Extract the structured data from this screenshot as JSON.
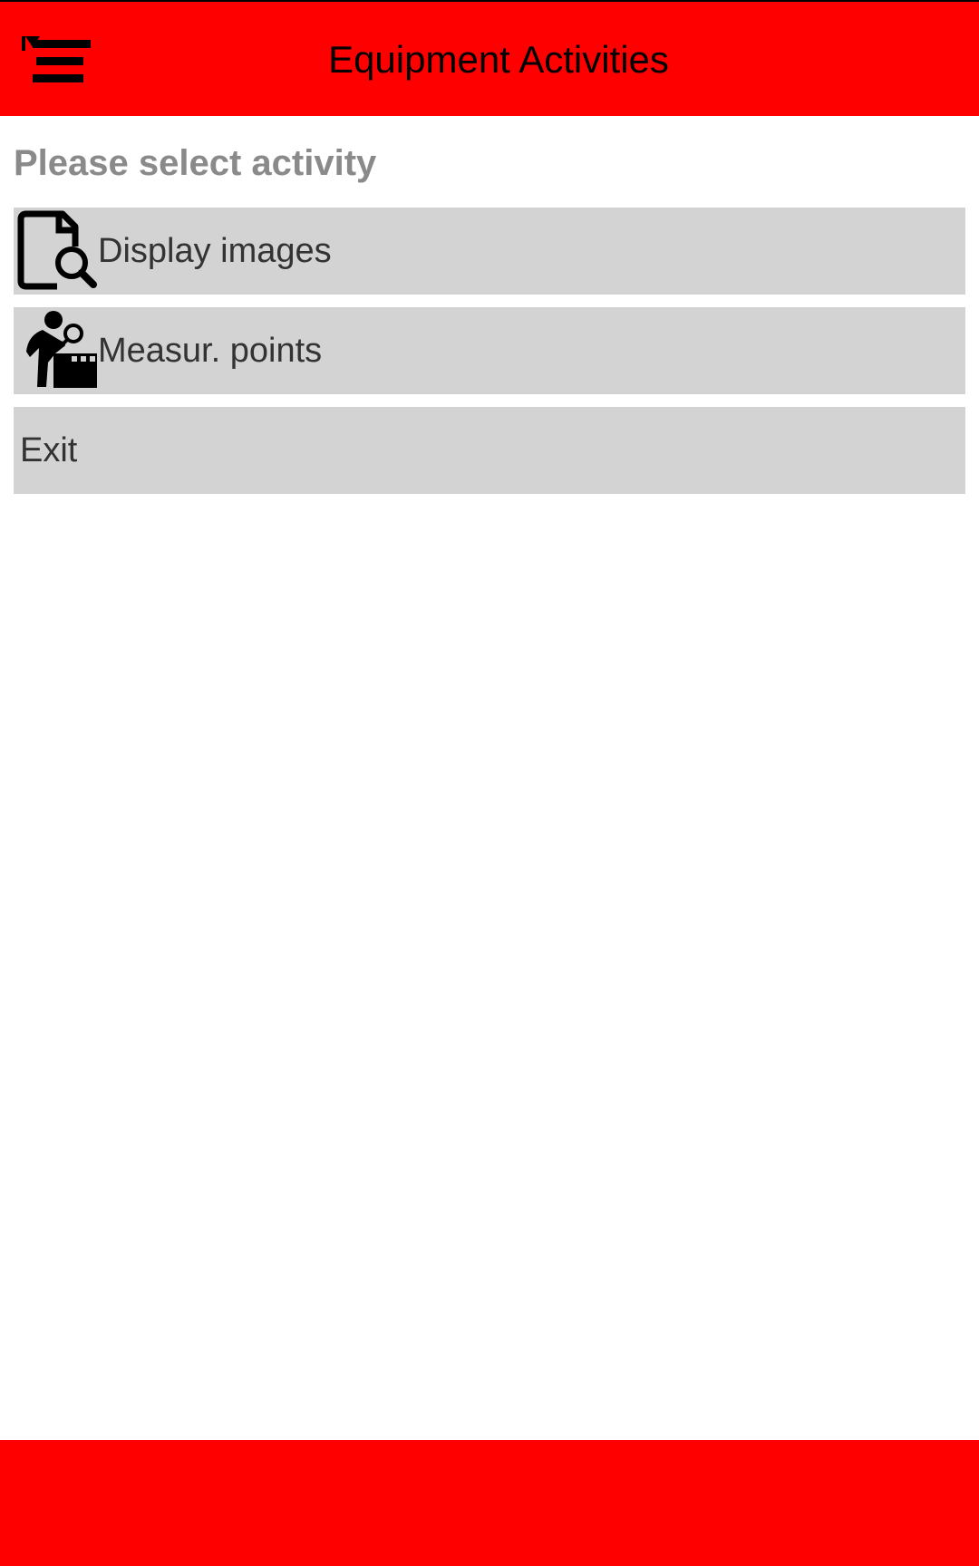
{
  "header": {
    "title": "Equipment Activities",
    "menu_icon": "menu-icon",
    "background_color": "#ff0000"
  },
  "main": {
    "heading": "Please select activity",
    "actions": [
      {
        "label": "Display images",
        "icon": "document-search-icon"
      },
      {
        "label": "Measur. points",
        "icon": "worker-inspection-icon"
      },
      {
        "label": "Exit"
      }
    ]
  },
  "footer": {
    "background_color": "#ff0000"
  },
  "colors": {
    "accent": "#ff0000",
    "item_background": "#d3d3d3",
    "heading_text": "#8a8a8a",
    "item_text": "#333333"
  }
}
